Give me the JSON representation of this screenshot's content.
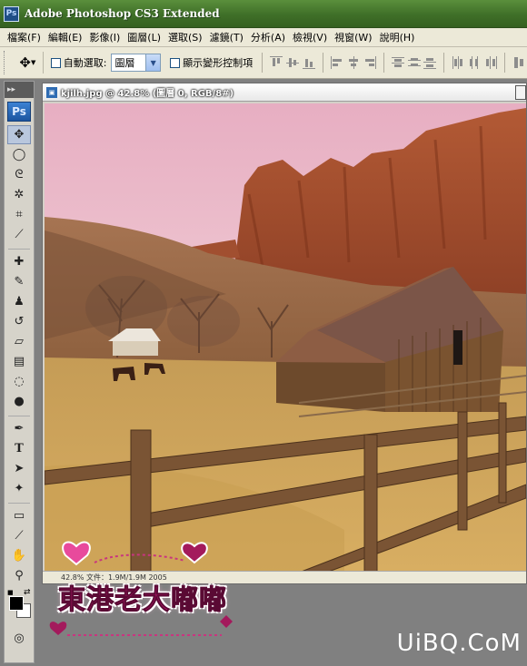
{
  "window": {
    "title": "Adobe Photoshop CS3 Extended",
    "app_icon": "Ps"
  },
  "menu": [
    "檔案(F)",
    "編輯(E)",
    "影像(I)",
    "圖層(L)",
    "選取(S)",
    "濾鏡(T)",
    "分析(A)",
    "檢視(V)",
    "視窗(W)",
    "說明(H)"
  ],
  "options": {
    "auto_select_label": "自動選取:",
    "auto_select_value": "圖層",
    "show_transform_label": "顯示變形控制項"
  },
  "toolbox": {
    "logo": "Ps"
  },
  "document": {
    "title": "kjilh.jpg @ 42.8% (圖層 0, RGB/8#)",
    "status_text": "42.8%  文件：1.9M/1.9M  2005"
  },
  "watermark": {
    "text": "東港老大嘟嘟"
  },
  "site": {
    "text": "UiBQ.CoM"
  },
  "colors": {
    "titlebar": "#3f6f28",
    "menubar": "#ece9d8",
    "workspace": "#808080",
    "watermark_pink": "#d9177f"
  }
}
